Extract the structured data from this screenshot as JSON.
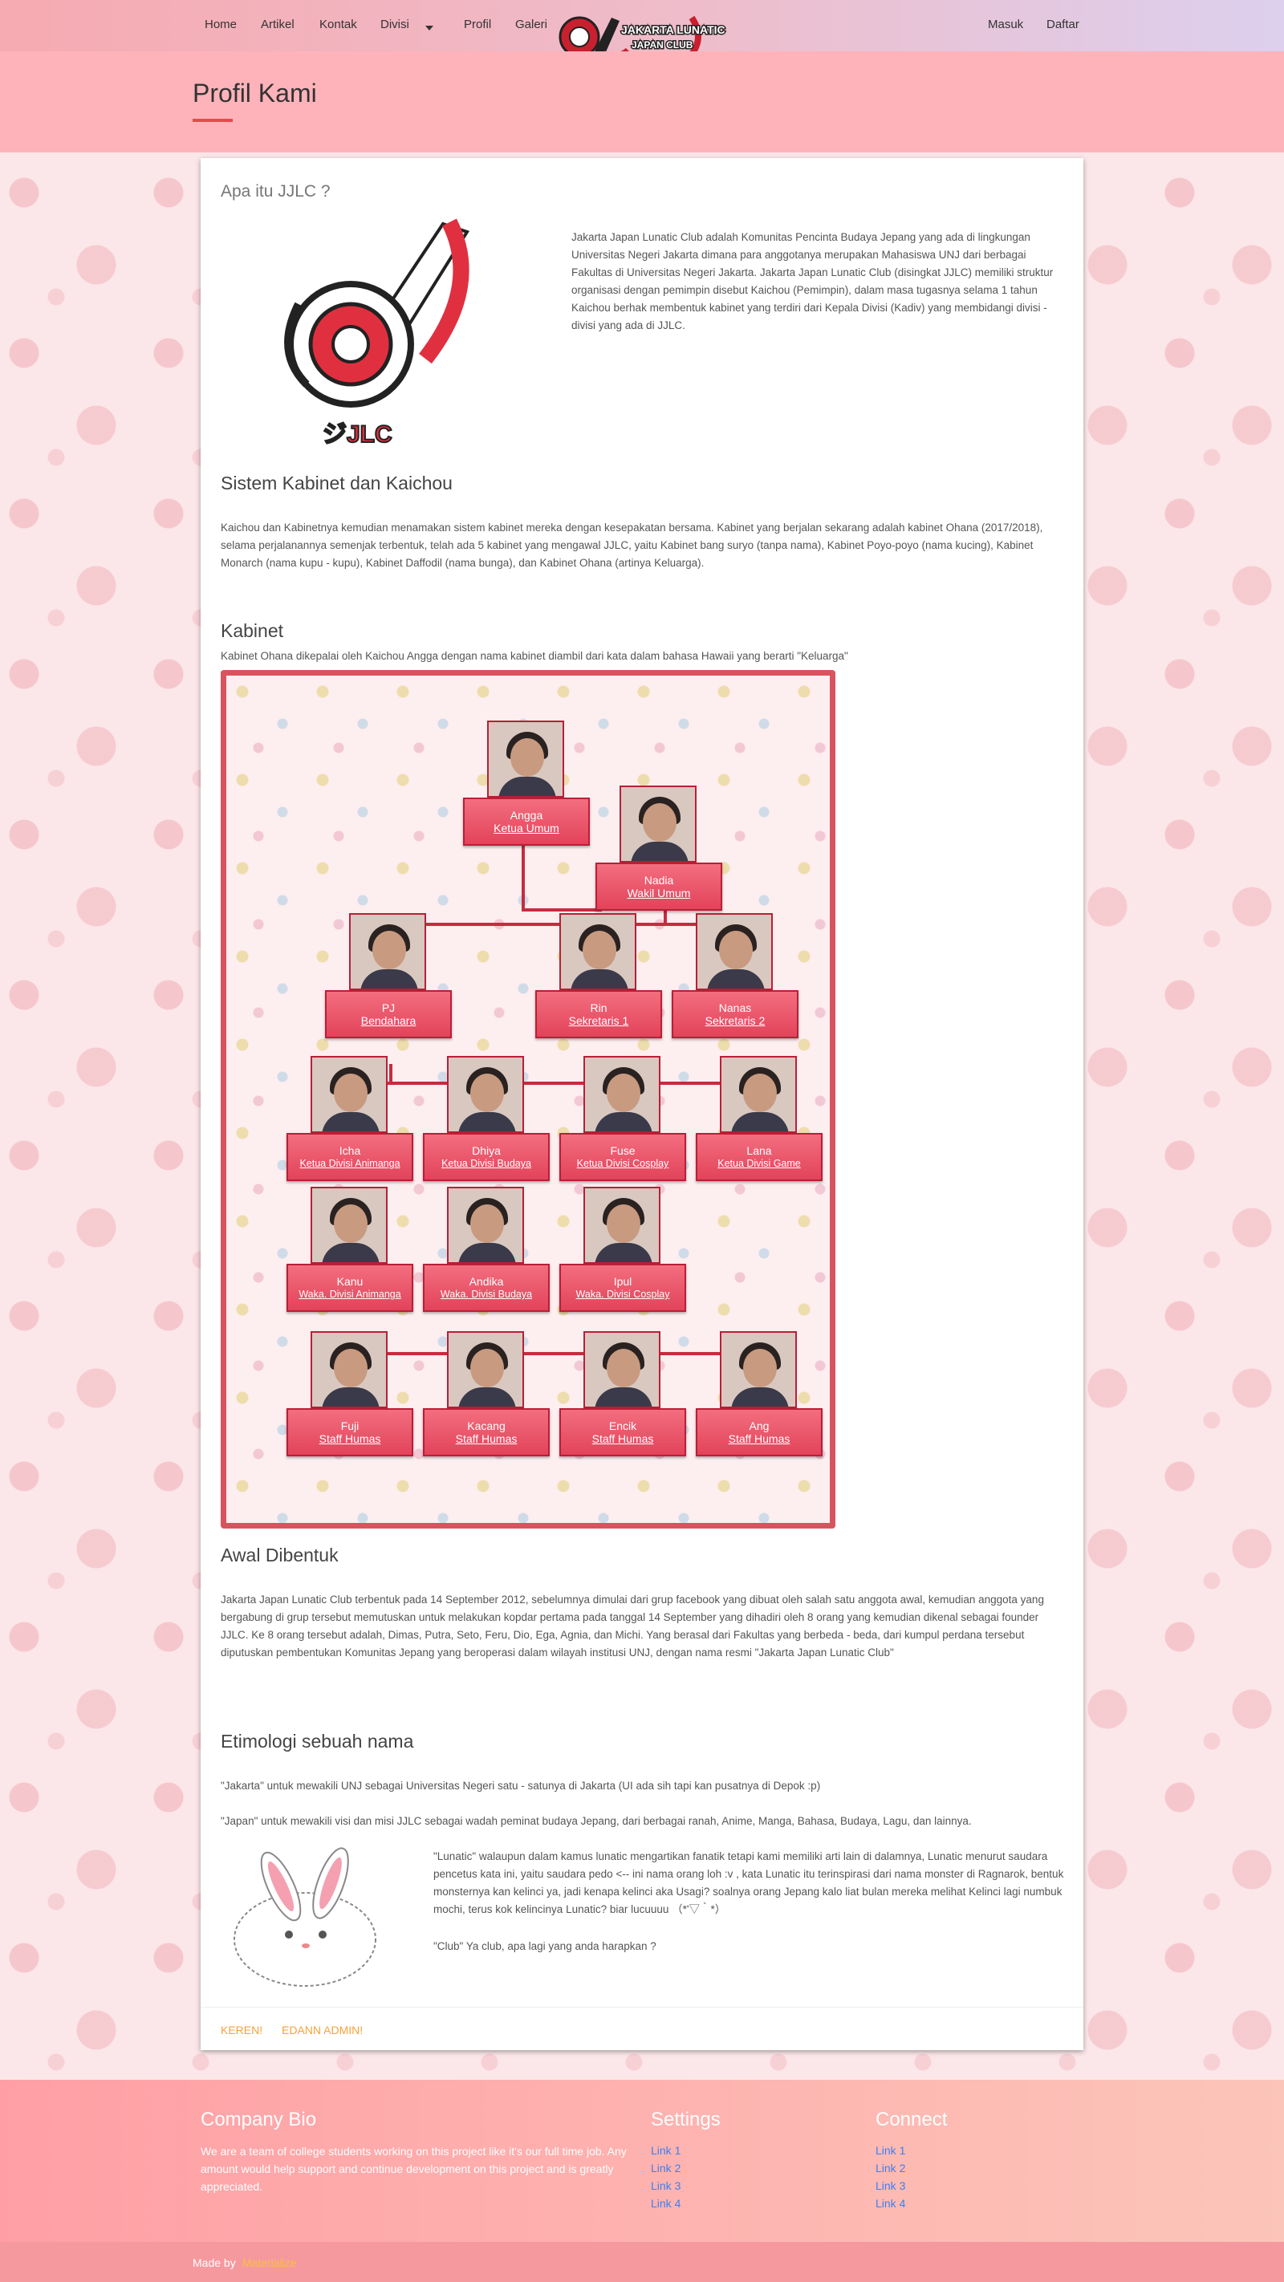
{
  "nav": {
    "left": [
      "Home",
      "Artikel",
      "Kontak",
      "Divisi",
      "Profil",
      "Galeri"
    ],
    "right": [
      "Masuk",
      "Daftar"
    ],
    "logo_text": "JAKARTA JAPAN LUNATIC CLUB"
  },
  "page_title": "Profil Kami",
  "sections": {
    "about_title": "Apa itu JJLC ?",
    "about_text": "Jakarta Japan Lunatic Club adalah Komunitas Pencinta Budaya Jepang yang ada di lingkungan Universitas Negeri Jakarta dimana para anggotanya merupakan Mahasiswa UNJ dari berbagai Fakultas di Universitas Negeri Jakarta. Jakarta Japan Lunatic Club (disingkat JJLC) memiliki struktur organisasi dengan pemimpin disebut Kaichou (Pemimpin), dalam masa tugasnya selama 1 tahun Kaichou berhak membentuk kabinet yang terdiri dari Kepala Divisi (Kadiv) yang membidangi divisi - divisi yang ada di JJLC.",
    "kabinet_sys_title": "Sistem Kabinet dan Kaichou",
    "kabinet_sys_text": "Kaichou dan Kabinetnya kemudian menamakan sistem kabinet mereka dengan kesepakatan bersama. Kabinet yang berjalan sekarang adalah kabinet Ohana (2017/2018), selama perjalanannya semenjak terbentuk, telah ada 5 kabinet yang mengawal JJLC, yaitu Kabinet bang suryo (tanpa nama), Kabinet Poyo-poyo (nama kucing), Kabinet Monarch (nama kupu - kupu), Kabinet Daffodil (nama bunga), dan Kabinet Ohana (artinya Keluarga).",
    "kabinet_title": "Kabinet",
    "kabinet_text": "Kabinet Ohana dikepalai oleh Kaichou Angga dengan nama kabinet diambil dari kata dalam bahasa Hawaii yang berarti \"Keluarga\"",
    "awal_title": "Awal Dibentuk",
    "awal_text": "Jakarta Japan Lunatic Club terbentuk pada 14 September 2012, sebelumnya dimulai dari grup facebook yang dibuat oleh salah satu anggota awal, kemudian anggota yang bergabung di grup tersebut memutuskan untuk melakukan kopdar pertama pada tanggal 14 September yang dihadiri oleh 8 orang yang kemudian dikenal sebagai founder JJLC. Ke 8 orang tersebut adalah, Dimas, Putra, Seto, Feru, Dio, Ega, Agnia, dan Michi. Yang berasal dari Fakultas yang berbeda - beda, dari kumpul perdana tersebut diputuskan pembentukan Komunitas Jepang yang beroperasi dalam wilayah institusi UNJ, dengan nama resmi \"Jakarta Japan Lunatic Club\"",
    "etim_title": "Etimologi sebuah nama",
    "etim_1": "\"Jakarta\" untuk mewakili UNJ sebagai Universitas Negeri satu - satunya di Jakarta (UI ada sih tapi kan pusatnya di Depok :p)",
    "etim_2": "\"Japan\" untuk mewakili visi dan misi JJLC sebagai wadah peminat budaya Jepang, dari berbagai ranah, Anime, Manga, Bahasa, Budaya, Lagu, dan lainnya.",
    "etim_3": "\"Lunatic\" walaupun dalam kamus lunatic mengartikan fanatik tetapi kami memiliki arti lain di dalamnya, Lunatic menurut saudara pencetus kata ini, yaitu saudara pedo <-- ini nama orang loh :v , kata Lunatic itu terinspirasi dari nama monster di Ragnarok, bentuk monsternya kan kelinci ya, jadi kenapa kelinci aka Usagi? soalnya orang Jepang kalo liat bulan mereka melihat Kelinci lagi numbuk mochi, terus kok kelincinya Lunatic? biar lucuuuu （*'▽｀*）",
    "etim_4": "\"Club\" Ya club, apa lagi yang anda harapkan ?"
  },
  "org": [
    {
      "name": "Angga",
      "role": "Ketua Umum"
    },
    {
      "name": "Nadia",
      "role": "Wakil Umum"
    },
    {
      "name": "PJ",
      "role": "Bendahara"
    },
    {
      "name": "Rin",
      "role": "Sekretaris 1"
    },
    {
      "name": "Nanas",
      "role": "Sekretaris 2"
    },
    {
      "name": "Icha",
      "role": "Ketua Divisi Animanga"
    },
    {
      "name": "Dhiya",
      "role": "Ketua Divisi Budaya"
    },
    {
      "name": "Fuse",
      "role": "Ketua Divisi Cosplay"
    },
    {
      "name": "Lana",
      "role": "Ketua Divisi Game"
    },
    {
      "name": "Kanu",
      "role": "Waka. Divisi Animanga"
    },
    {
      "name": "Andika",
      "role": "Waka. Divisi Budaya"
    },
    {
      "name": "Ipul",
      "role": "Waka. Divisi Cosplay"
    },
    {
      "name": "Fuji",
      "role": "Staff Humas"
    },
    {
      "name": "Kacang",
      "role": "Staff Humas"
    },
    {
      "name": "Encik",
      "role": "Staff Humas"
    },
    {
      "name": "Ang",
      "role": "Staff Humas"
    }
  ],
  "card_actions": [
    "KEREN!",
    "EDANN ADMIN!"
  ],
  "footer": {
    "bio_title": "Company Bio",
    "bio_text": "We are a team of college students working on this project like it's our full time job. Any amount would help support and continue development on this project and is greatly appreciated.",
    "settings_title": "Settings",
    "settings_links": [
      "Link 1",
      "Link 2",
      "Link 3",
      "Link 4"
    ],
    "connect_title": "Connect",
    "connect_links": [
      "Link 1",
      "Link 2",
      "Link 3",
      "Link 4"
    ],
    "made_by": "Made by",
    "made_by_link": "Materialize"
  },
  "colors": {
    "accent": "#e84b4b",
    "node": "#e2435a",
    "footer_link": "#3d7ff0",
    "action": "#f7a23a"
  }
}
